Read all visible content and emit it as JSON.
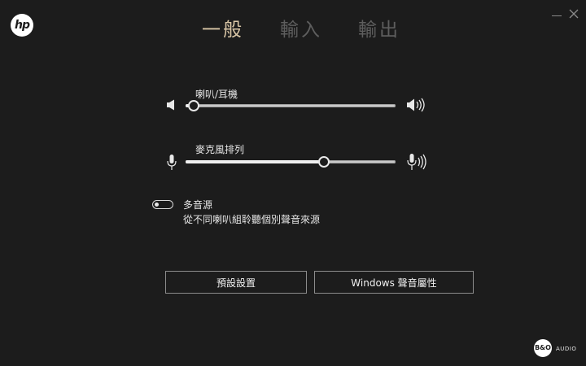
{
  "brand": {
    "logo_text": "hp"
  },
  "tabs": [
    {
      "label": "一般",
      "active": true
    },
    {
      "label": "輸入",
      "active": false
    },
    {
      "label": "輸出",
      "active": false
    }
  ],
  "window": {
    "minimize_icon": "minimize-icon",
    "close_icon": "close-icon"
  },
  "speaker": {
    "label": "喇叭/耳機",
    "level": 0.04,
    "icon_low": "speaker-low-icon",
    "icon_high": "speaker-high-icon"
  },
  "microphone": {
    "label": "麥克風排列",
    "level": 0.66,
    "icon_low": "microphone-low-icon",
    "icon_high": "microphone-high-icon"
  },
  "multi_stream": {
    "title": "多音源",
    "description": "從不同喇叭組聆聽個別聲音來源",
    "enabled": false
  },
  "buttons": {
    "default_label": "預設設置",
    "windows_label": "Windows 聲音屬性"
  },
  "partner": {
    "logo_text": "B&O",
    "audio_text": "AUDIO"
  },
  "colors": {
    "background": "#1c1c1c",
    "active_tab": "#d9c6a6",
    "inactive_tab": "#5e5e5e"
  }
}
